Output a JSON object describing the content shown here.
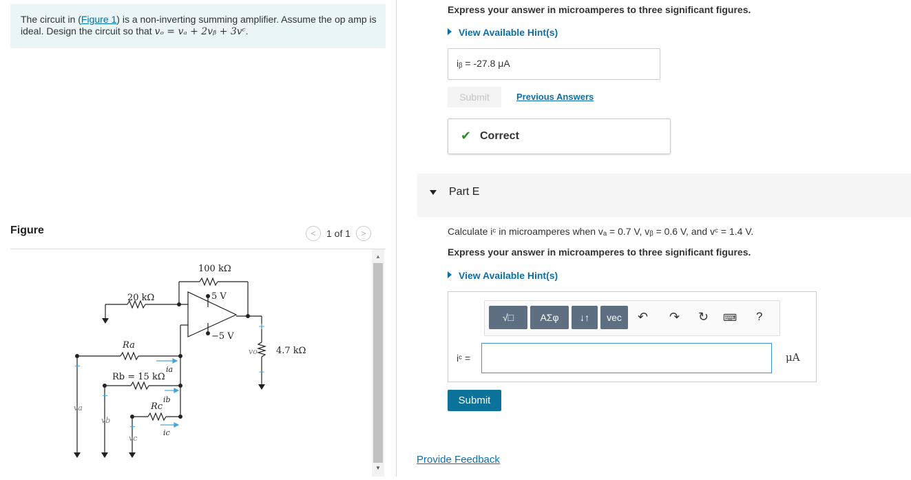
{
  "problem": {
    "intro": "The circuit in (",
    "figure_link": "Figure 1",
    "rest": ") is a non-inverting summing amplifier. Assume the op amp is ideal. Design the circuit so that ",
    "equation": "vₒ = vₐ + 2vᵦ + 3vᶜ",
    "end": "."
  },
  "figure": {
    "title": "Figure",
    "pager": "1 of 1",
    "labels": {
      "r_feedback": "100 kΩ",
      "r_top": "20 kΩ",
      "vplus": "5 V",
      "vminus": "−5 V",
      "ra": "Ra",
      "rb": "Rb = 15 kΩ",
      "rc": "Rc",
      "rload": "4.7 kΩ",
      "ia": "ia",
      "ib": "ib",
      "ic": "ic",
      "vo": "vo",
      "va": "va",
      "vb": "vb",
      "vc": "vc",
      "plus": "+",
      "minus": "−"
    }
  },
  "part_d": {
    "instruction": "Express your answer in microamperes to three significant figures.",
    "hint": "View Available Hint(s)",
    "answer": "iᵦ =  -27.8  μA",
    "submit": "Submit",
    "previous": "Previous Answers",
    "status": "Correct"
  },
  "part_e": {
    "title": "Part E",
    "question": "Calculate iᶜ in microamperes when vₐ = 0.7 V, vᵦ = 0.6 V, and vᶜ = 1.4 V.",
    "instruction": "Express your answer in microamperes to three significant figures.",
    "hint": "View Available Hint(s)",
    "toolbar": [
      "√□",
      "ΑΣφ",
      "↓↑",
      "vec"
    ],
    "toolbar_icons": [
      "undo-icon",
      "redo-icon",
      "reset-icon",
      "keyboard-icon",
      "help-icon"
    ],
    "input_label": "iᶜ =",
    "input_value": "",
    "unit": "μA",
    "submit": "Submit"
  },
  "footer": {
    "feedback": "Provide Feedback"
  }
}
